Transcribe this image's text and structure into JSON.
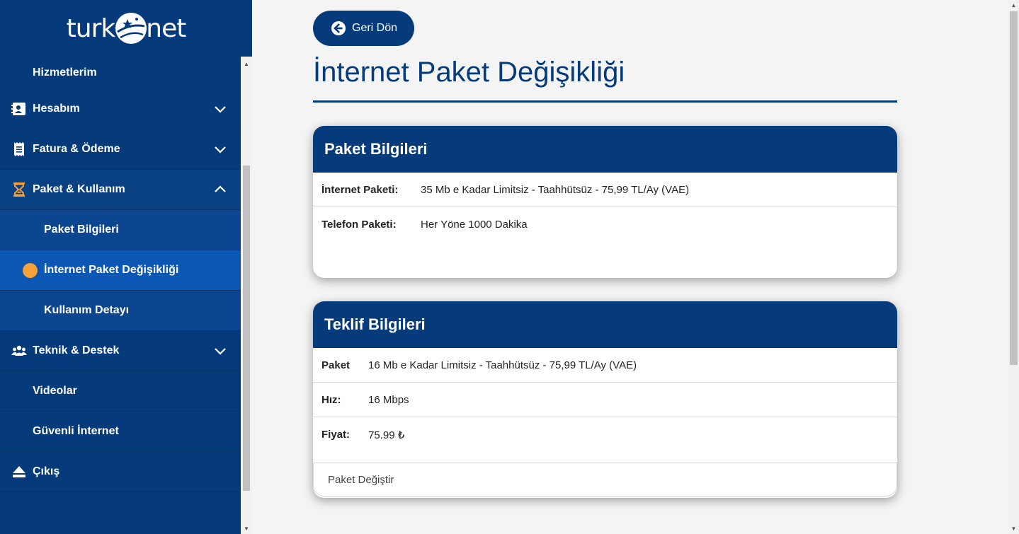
{
  "brand": {
    "left": "turk",
    "right": "net"
  },
  "sidebar": {
    "items": [
      {
        "label": "Hizmetlerim"
      },
      {
        "label": "Hesabım",
        "icon": "id-card-icon"
      },
      {
        "label": "Fatura & Ödeme",
        "icon": "receipt-icon"
      },
      {
        "label": "Paket & Kullanım",
        "icon": "hourglass-icon"
      },
      {
        "label": "Paket Bilgileri"
      },
      {
        "label": "İnternet Paket Değişikliği"
      },
      {
        "label": "Kullanım Detayı"
      },
      {
        "label": "Teknik & Destek",
        "icon": "people-icon"
      },
      {
        "label": "Videolar"
      },
      {
        "label": "Güvenli İnternet"
      },
      {
        "label": "Çıkış",
        "icon": "eject-icon"
      }
    ]
  },
  "main": {
    "back_label": "Geri Dön",
    "title": "İnternet Paket Değişikliği",
    "package_card": {
      "title": "Paket Bilgileri",
      "rows": [
        {
          "key": "İnternet Paketi:",
          "value": "35 Mb e Kadar Limitsiz - Taahhütsüz - 75,99 TL/Ay (VAE)"
        },
        {
          "key": "Telefon Paketi:",
          "value": "Her Yöne 1000 Dakika"
        }
      ]
    },
    "offer_card": {
      "title": "Teklif Bilgileri",
      "rows": [
        {
          "key": "Paket",
          "value": "16 Mb e Kadar Limitsiz - Taahhütsüz - 75,99 TL/Ay (VAE)"
        },
        {
          "key": "Hız:",
          "value": "16 Mbps"
        },
        {
          "key": "Fiyat:",
          "value": "75.99 ₺"
        }
      ],
      "action_label": "Paket Değiştir"
    }
  },
  "colors": {
    "primary": "#053a7b",
    "accent": "#f5a23b",
    "active": "#0c56b4"
  }
}
